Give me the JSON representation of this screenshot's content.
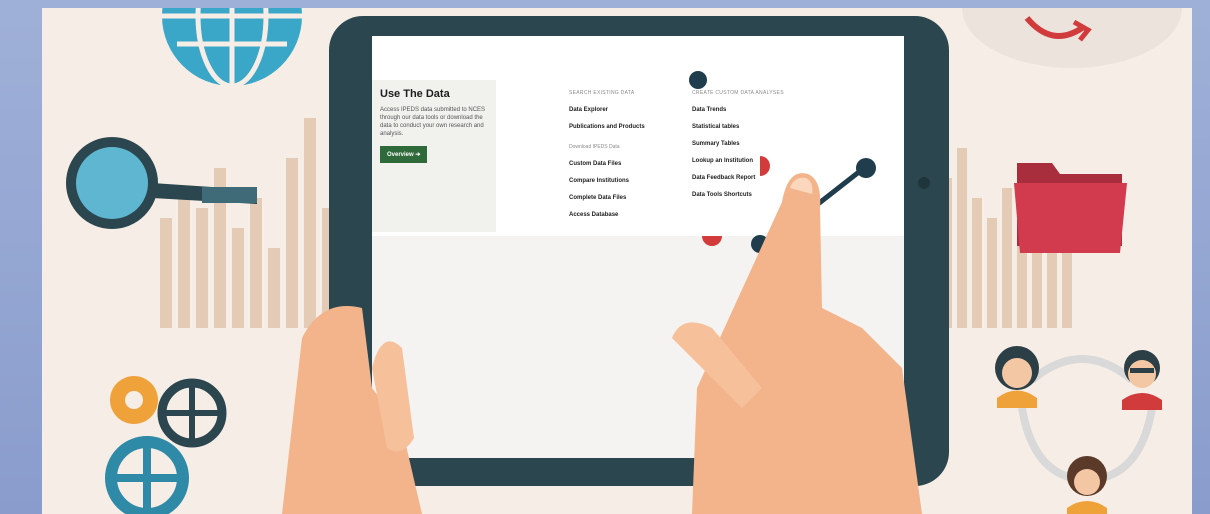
{
  "menu": {
    "title": "Use The Data",
    "description": "Access IPEDS data submitted to NCES through our data tools or download the data to conduct your own research and analysis.",
    "overview_button": "Overview ➔",
    "search_heading": "SEARCH EXISTING DATA",
    "search_links": [
      "Data Explorer",
      "Publications and Products"
    ],
    "download_heading": "Download IPEDS Data",
    "download_links": [
      "Custom Data Files",
      "Compare Institutions",
      "Complete Data Files",
      "Access Database"
    ],
    "create_heading": "CREATE CUSTOM DATA ANALYSES",
    "create_links": [
      "Data Trends",
      "Statistical tables",
      "Summary Tables",
      "Lookup an Institution",
      "Data Feedback Report",
      "Data Tools Shortcuts"
    ]
  },
  "colors": {
    "page_border": "#9fb0d8",
    "background": "#f6eee6",
    "tablet": "#2c4650",
    "button_green": "#2f6b3a",
    "accent_red": "#d23b3b",
    "accent_blue": "#3aa6c8",
    "accent_orange": "#f0a23a"
  },
  "icons": [
    "globe-icon",
    "magnifier-icon",
    "folder-icon",
    "cloud-icon",
    "gear-icon",
    "user-network-icon",
    "line-chart-icon"
  ]
}
